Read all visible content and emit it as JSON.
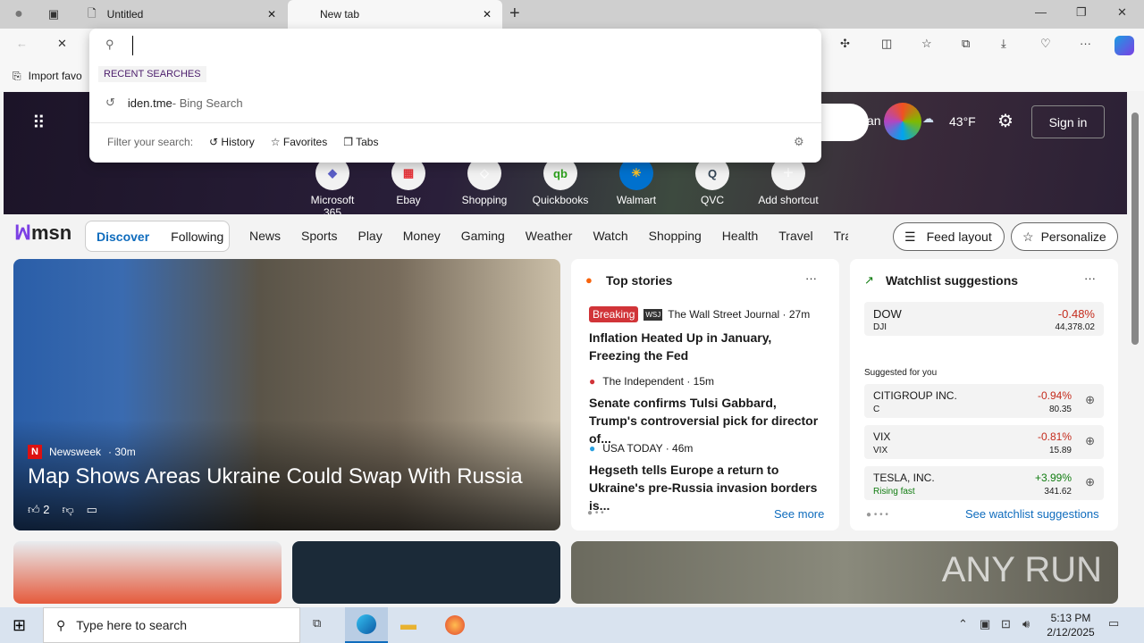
{
  "tabs": [
    {
      "label": "Untitled"
    },
    {
      "label": "New tab"
    }
  ],
  "favorites_bar": {
    "import_label": "Import favo"
  },
  "dropdown": {
    "section": "RECENT SEARCHES",
    "item_query": "iden.tme",
    "item_suffix": " - Bing Search",
    "filter_label": "Filter your search:",
    "filters": [
      "History",
      "Favorites",
      "Tabs"
    ]
  },
  "hero": {
    "location_partial": "an",
    "weather_temp": "43°F",
    "sign_in": "Sign in",
    "shortcuts": [
      "Microsoft 365",
      "Ebay",
      "Shopping",
      "Quickbooks",
      "Walmart",
      "QVC",
      "Add shortcut"
    ]
  },
  "nav": {
    "brand": "msn",
    "toggle": [
      "Discover",
      "Following"
    ],
    "items": [
      "News",
      "Sports",
      "Play",
      "Money",
      "Gaming",
      "Weather",
      "Watch",
      "Shopping",
      "Health",
      "Travel",
      "Tra"
    ],
    "feed_layout": "Feed layout",
    "personalize": "Personalize"
  },
  "main_story": {
    "source": "Newsweek",
    "time": "· 30m",
    "headline": "Map Shows Areas Ukraine Could Swap With Russia",
    "likes": "2"
  },
  "top_stories": {
    "title": "Top stories",
    "see_more": "See more",
    "items": [
      {
        "badge": "Breaking",
        "source": "The Wall Street Journal · 27m",
        "headline": "Inflation Heated Up in January, Freezing the Fed"
      },
      {
        "source": "The Independent · 15m",
        "headline": "Senate confirms Tulsi Gabbard, Trump's controversial pick for director of..."
      },
      {
        "source": "USA TODAY · 46m",
        "headline": "Hegseth tells Europe a return to Ukraine's pre-Russia invasion borders is..."
      }
    ]
  },
  "watchlist": {
    "title": "Watchlist suggestions",
    "suggested_label": "Suggested for you",
    "see_link": "See watchlist suggestions",
    "dow": {
      "name": "DOW",
      "symbol": "DJI",
      "change": "-0.48%",
      "price": "44,378.02"
    },
    "stocks": [
      {
        "name": "CITIGROUP INC.",
        "symbol": "C",
        "change": "-0.94%",
        "price": "80.35"
      },
      {
        "name": "VIX",
        "symbol": "VIX",
        "change": "-0.81%",
        "price": "15.89"
      },
      {
        "name": "TESLA, INC.",
        "symbol": "Rising fast",
        "change": "+3.99%",
        "price": "341.62"
      }
    ]
  },
  "watermark": "ANY RUN",
  "taskbar": {
    "search_placeholder": "Type here to search",
    "time": "5:13 PM",
    "date": "2/12/2025"
  }
}
